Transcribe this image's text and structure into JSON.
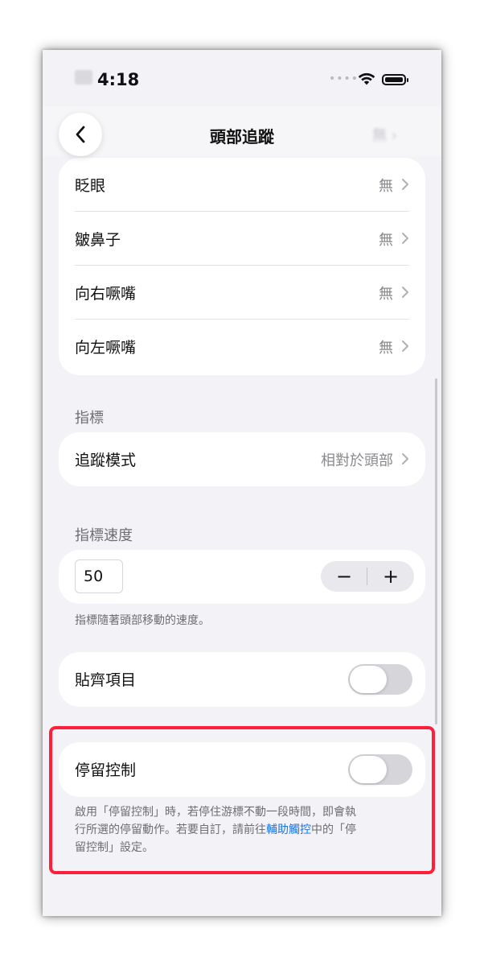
{
  "status": {
    "time": "4:18"
  },
  "nav": {
    "title": "頭部追蹤"
  },
  "face_gestures": [
    {
      "label": "眨眼",
      "value": "無"
    },
    {
      "label": "皺鼻子",
      "value": "無"
    },
    {
      "label": "向右噘嘴",
      "value": "無"
    },
    {
      "label": "向左噘嘴",
      "value": "無"
    }
  ],
  "pointer": {
    "section": "指標",
    "tracking_mode": {
      "label": "追蹤模式",
      "value": "相對於頭部"
    }
  },
  "pointer_speed": {
    "section": "指標速度",
    "value": "50",
    "minus": "−",
    "plus": "+",
    "footnote": "指標隨著頭部移動的速度。"
  },
  "snap_items": {
    "label": "貼齊項目",
    "enabled": false
  },
  "dwell_control": {
    "label": "停留控制",
    "enabled": false,
    "footnote_before": "啟用「停留控制」時，若停住游標不動一段時間，即會執",
    "footnote_line2_before": "行所選的停留動作。若要自訂，請前往",
    "footnote_link": "輔助觸控",
    "footnote_line2_after": "中的「停",
    "footnote_line3": "留控制」設定。"
  },
  "colors": {
    "highlight": "#ff1f3a",
    "link": "#1a73e8",
    "background": "#f2f2f7"
  },
  "icons": [
    "back-chevron-icon",
    "chevron-right-icon",
    "wifi-icon",
    "battery-icon",
    "cellular-dots-icon"
  ]
}
